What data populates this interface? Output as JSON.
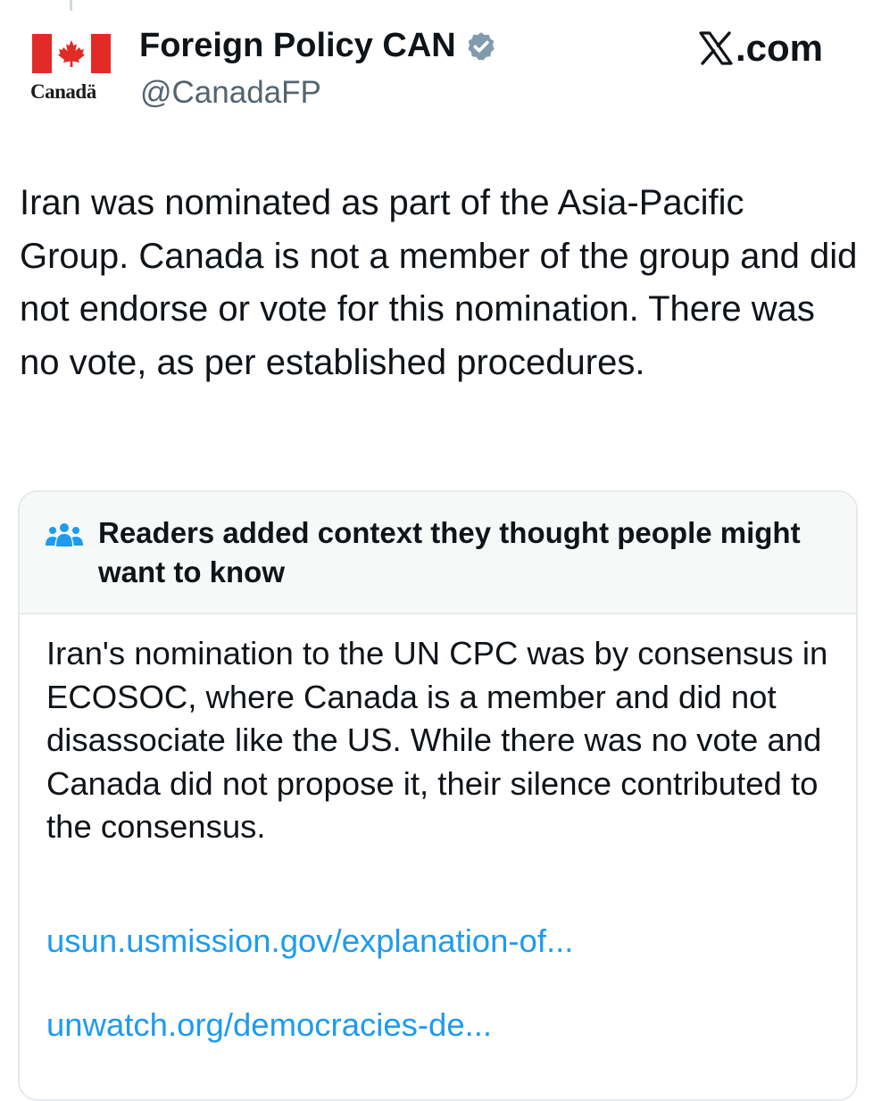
{
  "account": {
    "display_name": "Foreign Policy CAN",
    "handle": "@CanadaFP",
    "avatar_wordmark": "Canadä"
  },
  "site": {
    "label": ".com",
    "logo_icon": "x-logo-icon"
  },
  "tweet": {
    "text": "Iran was nominated as part of the Asia-Pacific Group. Canada is not a member of the group and did not endorse or vote for this nomination. There was no vote, as per established procedures."
  },
  "community_note": {
    "title": "Readers added context they thought people might want to know",
    "icon": "people-icon",
    "body": "Iran's nomination to the UN CPC was by consensus in ECOSOC, where Canada is a member and did not disassociate like the US. While there was no vote and Canada did not propose it, their silence contributed to the consensus.",
    "links": [
      "usun.usmission.gov/explanation-of...",
      "unwatch.org/democracies-de..."
    ]
  },
  "colors": {
    "text_primary": "#0f1419",
    "text_secondary": "#536471",
    "link": "#1d9bf0",
    "flag_red": "#e22b26",
    "verified_badge": "#829aab",
    "note_header_bg": "#f7f9f9",
    "note_border": "#e6eaed",
    "note_icon": "#1d9bf0"
  }
}
